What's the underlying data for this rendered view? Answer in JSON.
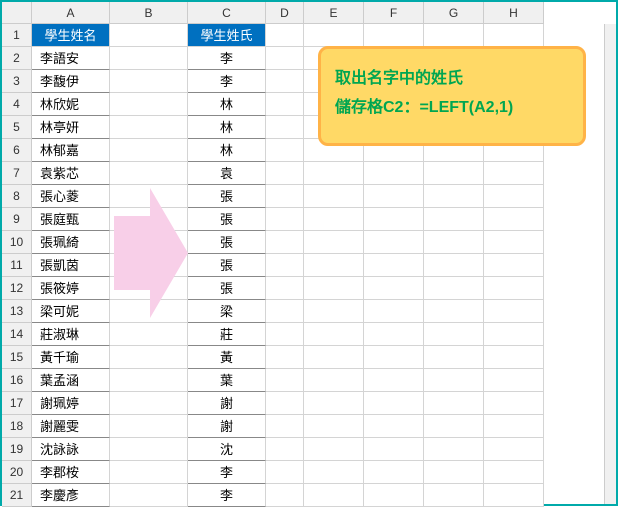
{
  "columns": [
    "A",
    "B",
    "C",
    "D",
    "E",
    "F",
    "G",
    "H"
  ],
  "rowCount": 21,
  "headers": {
    "a": "學生姓名",
    "c": "學生姓氏"
  },
  "names": [
    "李語安",
    "李馥伊",
    "林欣妮",
    "林亭妍",
    "林郁嘉",
    "袁紫芯",
    "張心菱",
    "張庭甄",
    "張珮綺",
    "張凱茵",
    "張筱婷",
    "梁可妮",
    "莊淑琳",
    "黃千瑜",
    "葉孟涵",
    "謝珮婷",
    "謝麗雯",
    "沈詠詠",
    "李郡桉",
    "李慶彥"
  ],
  "surnames": [
    "李",
    "李",
    "林",
    "林",
    "林",
    "袁",
    "張",
    "張",
    "張",
    "張",
    "張",
    "梁",
    "莊",
    "黃",
    "葉",
    "謝",
    "謝",
    "沈",
    "李",
    "李"
  ],
  "callout": {
    "line1": "取出名字中的姓氏",
    "line2": "儲存格C2：=LEFT(A2,1)"
  }
}
